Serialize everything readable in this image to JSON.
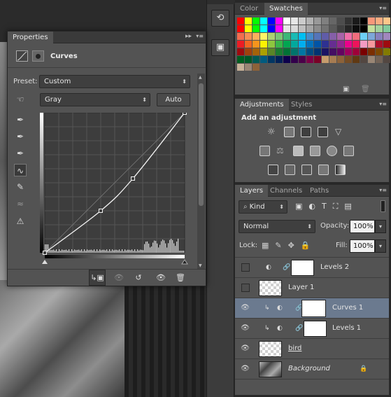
{
  "properties": {
    "title": "Properties",
    "icon": "curves-adjustment-icon",
    "heading": "Curves",
    "preset_label": "Preset:",
    "preset_value": "Custom",
    "channel_value": "Gray",
    "auto_label": "Auto",
    "curve_points": [
      [
        0,
        0
      ],
      [
        0.4,
        0.3
      ],
      [
        0.63,
        0.53
      ],
      [
        1,
        1
      ]
    ]
  },
  "swatches": {
    "tabs": [
      "Color",
      "Swatches"
    ],
    "active_tab": "Swatches",
    "colors": [
      "#ff0000",
      "#ffff00",
      "#00ff00",
      "#00ffff",
      "#0000ff",
      "#ff00ff",
      "#ffffff",
      "#e6e6e6",
      "#cccccc",
      "#b3b3b3",
      "#999999",
      "#808080",
      "#666666",
      "#4d4d4d",
      "#333333",
      "#1a1a1a",
      "#000000",
      "#f7977a",
      "#f9ad81",
      "#fdc68a",
      "#fff79a",
      "#ff0000",
      "#ffff00",
      "#00ff00",
      "#00ffff",
      "#0000ff",
      "#ff00ff",
      "#e6e6e6",
      "#d9d9d9",
      "#bfbfbf",
      "#a6a6a6",
      "#8c8c8c",
      "#737373",
      "#595959",
      "#404040",
      "#262626",
      "#0d0d0d",
      "#000000",
      "#c4df9b",
      "#a3d39c",
      "#82ca9d",
      "#7bcdc8",
      "#f26c4f",
      "#f68e55",
      "#fbaf5c",
      "#fff467",
      "#acd372",
      "#7cc576",
      "#3bb878",
      "#1abbb4",
      "#00bff3",
      "#438ccb",
      "#5574b9",
      "#605ca8",
      "#855fa8",
      "#a763a8",
      "#f06ea9",
      "#f26d7d",
      "#6dcff6",
      "#7da7d9",
      "#8781bd",
      "#a187be",
      "#bc8dbf",
      "#ed1c24",
      "#f26522",
      "#f7941d",
      "#fff200",
      "#8dc63f",
      "#39b54a",
      "#00a651",
      "#00a99d",
      "#00aeef",
      "#0072bc",
      "#0054a6",
      "#2e3192",
      "#662d91",
      "#92278f",
      "#ec008c",
      "#ed145b",
      "#f49ac2",
      "#f6989d",
      "#ab0f2a",
      "#9e0b0f",
      "#a0410d",
      "#9e0b0f",
      "#a0410d",
      "#a36209",
      "#aba000",
      "#598527",
      "#1a7b30",
      "#007236",
      "#00746b",
      "#0076a3",
      "#004b80",
      "#003471",
      "#1b1464",
      "#440e62",
      "#630460",
      "#9e005d",
      "#9e0039",
      "#790000",
      "#7b2e00",
      "#7d4900",
      "#827b00",
      "#406618",
      "#005e20",
      "#005826",
      "#005952",
      "#005b7f",
      "#003663",
      "#002157",
      "#0d004c",
      "#32004b",
      "#4b0049",
      "#7b0046",
      "#7a0026",
      "#c69c6d",
      "#a67c52",
      "#8c6239",
      "#754c24",
      "#603913",
      "#534741",
      "#998675",
      "#736357",
      "#534741",
      "#362f2d",
      "#c7b299",
      "#998675",
      "#8c6239"
    ]
  },
  "adjustments": {
    "tabs": [
      "Adjustments",
      "Styles"
    ],
    "active_tab": "Adjustments",
    "heading": "Add an adjustment"
  },
  "layers": {
    "tabs": [
      "Layers",
      "Channels",
      "Paths"
    ],
    "active_tab": "Layers",
    "filter_kind": "Kind",
    "blend_mode": "Normal",
    "opacity_label": "Opacity:",
    "opacity_value": "100%",
    "lock_label": "Lock:",
    "fill_label": "Fill:",
    "fill_value": "100%",
    "items": [
      {
        "name": "Levels 2",
        "visible": false,
        "type": "levels"
      },
      {
        "name": "Layer 1",
        "visible": false,
        "type": "pixel"
      },
      {
        "name": "Curves 1",
        "visible": true,
        "type": "curves",
        "selected": true
      },
      {
        "name": "Levels 1",
        "visible": true,
        "type": "levels"
      },
      {
        "name": "bird",
        "visible": true,
        "type": "pixel"
      },
      {
        "name": "Background",
        "visible": true,
        "type": "background"
      }
    ]
  }
}
